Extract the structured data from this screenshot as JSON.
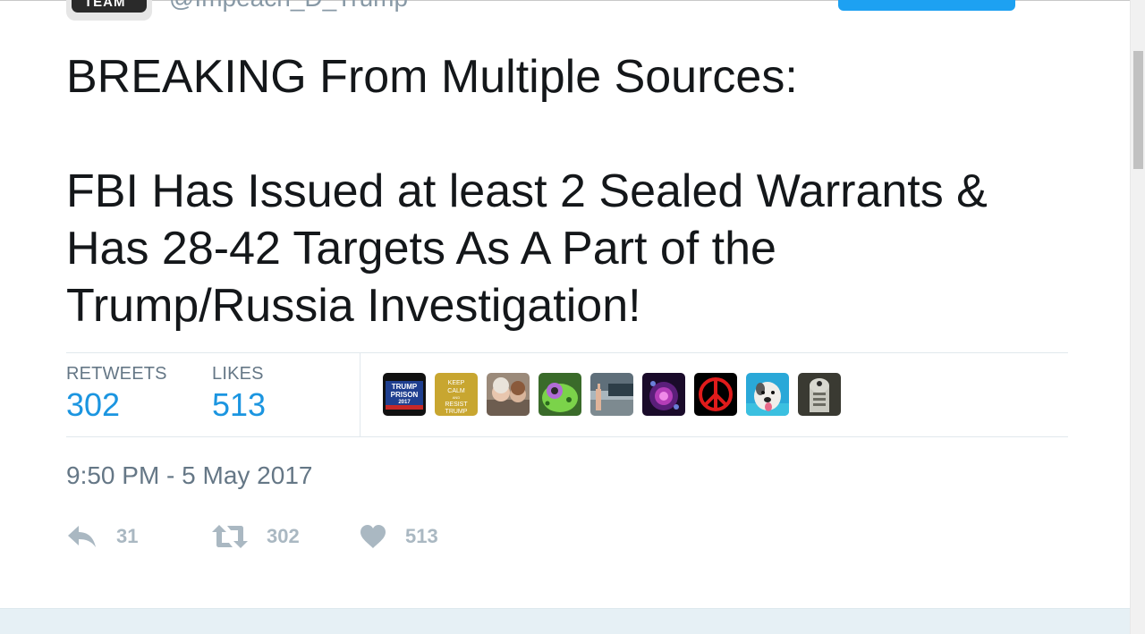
{
  "header": {
    "avatar_text": "TEAM",
    "handle": "@Impeach_D_Trump"
  },
  "tweet": {
    "lines": [
      "BREAKING From Multiple Sources:",
      "FBI Has Issued at least 2 Sealed Warrants &",
      "Has 28-42 Targets As A Part of the",
      "Trump/Russia Investigation!"
    ]
  },
  "stats": {
    "retweets_label": "RETWEETS",
    "retweets_value": "302",
    "likes_label": "LIKES",
    "likes_value": "513"
  },
  "liker_avatars": [
    {
      "name": "avatar-trump-prison",
      "text": [
        "TRUMP",
        "PRISON",
        "2017"
      ]
    },
    {
      "name": "avatar-keep-calm",
      "text": [
        "KEEP",
        "CALM",
        "AND",
        "RESIST",
        "TRUMP"
      ]
    },
    {
      "name": "avatar-photo-people"
    },
    {
      "name": "avatar-green-frog"
    },
    {
      "name": "avatar-photo-street"
    },
    {
      "name": "avatar-purple-abstract"
    },
    {
      "name": "avatar-peace-sign"
    },
    {
      "name": "avatar-dog"
    },
    {
      "name": "avatar-robot"
    }
  ],
  "timestamp": "9:50 PM - 5 May 2017",
  "actions": {
    "reply_icon": "reply-icon",
    "reply_count": "31",
    "retweet_icon": "retweet-icon",
    "retweet_count": "302",
    "like_icon": "heart-icon",
    "like_count": "513"
  },
  "colors": {
    "link_blue": "#1b95e0",
    "muted_gray": "#657786",
    "action_gray": "#aab8c2",
    "follow_blue": "#1da1f2"
  }
}
